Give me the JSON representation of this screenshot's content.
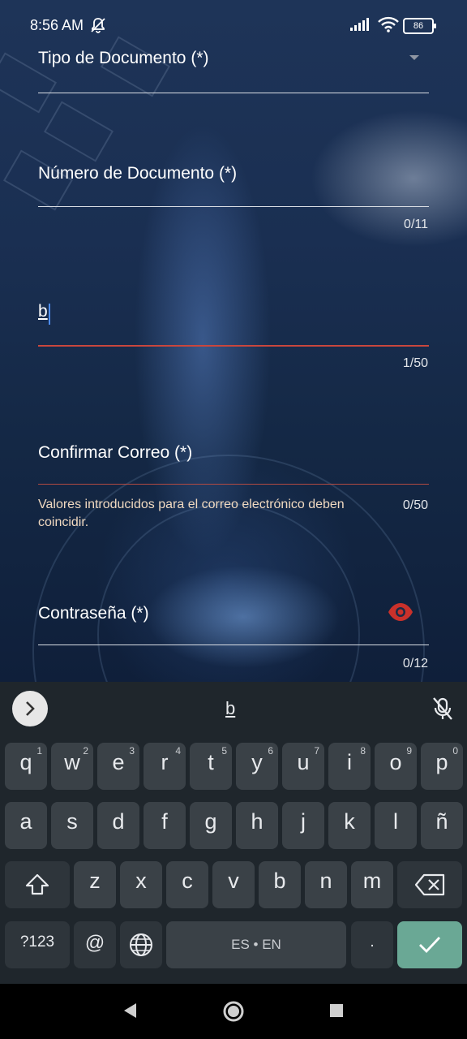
{
  "status_bar": {
    "time": "8:56 AM",
    "battery": "86"
  },
  "form": {
    "tipo_documento": {
      "label": "Tipo de Documento (*)"
    },
    "numero_documento": {
      "label": "Número de Documento (*)",
      "counter": "0/11"
    },
    "correo": {
      "value": "b",
      "counter": "1/50",
      "accent_color": "#c9463d"
    },
    "confirmar_correo": {
      "label": "Confirmar Correo (*)",
      "counter": "0/50",
      "error": "Valores introducidos para el correo electrónico deben coincidir."
    },
    "contrasena": {
      "label": "Contraseña (*)",
      "counter": "0/12",
      "eye_icon": "eye-icon",
      "eye_color": "#c9312b"
    }
  },
  "keyboard": {
    "suggestion": "b",
    "row1": [
      "q",
      "w",
      "e",
      "r",
      "t",
      "y",
      "u",
      "i",
      "o",
      "p"
    ],
    "row1_hints": [
      "1",
      "2",
      "3",
      "4",
      "5",
      "6",
      "7",
      "8",
      "9",
      "0"
    ],
    "row2": [
      "a",
      "s",
      "d",
      "f",
      "g",
      "h",
      "j",
      "k",
      "l",
      "ñ"
    ],
    "row3": [
      "z",
      "x",
      "c",
      "v",
      "b",
      "n",
      "m"
    ],
    "symbols_key": "?123",
    "at_key": "@",
    "space_label": "ES • EN",
    "period_key": ".",
    "enter_color": "#6aa895"
  }
}
